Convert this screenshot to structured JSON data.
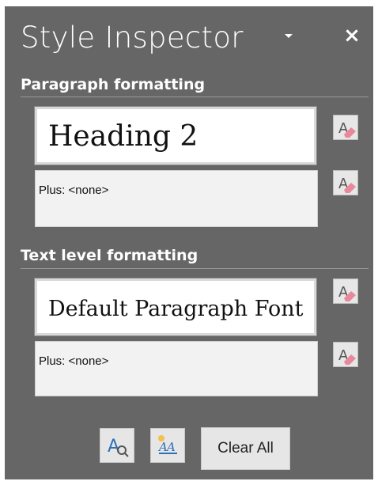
{
  "panel": {
    "title": "Style Inspector",
    "dropdown_icon": "chevron-down-icon",
    "close_label": "×"
  },
  "paragraph": {
    "header": "Paragraph formatting",
    "style_name": "Heading 2",
    "plus_text": "Plus: <none>"
  },
  "text_level": {
    "header": "Text level formatting",
    "style_name": "Default Paragraph Font",
    "plus_text": "Plus: <none>"
  },
  "footer": {
    "reveal_icon": "reveal-formatting-icon",
    "new_style_icon": "new-style-icon",
    "clear_all_label": "Clear All"
  },
  "colors": {
    "pane_bg": "#666666",
    "eraser_pink": "#e8889a",
    "icon_blue": "#2f6fb7"
  }
}
